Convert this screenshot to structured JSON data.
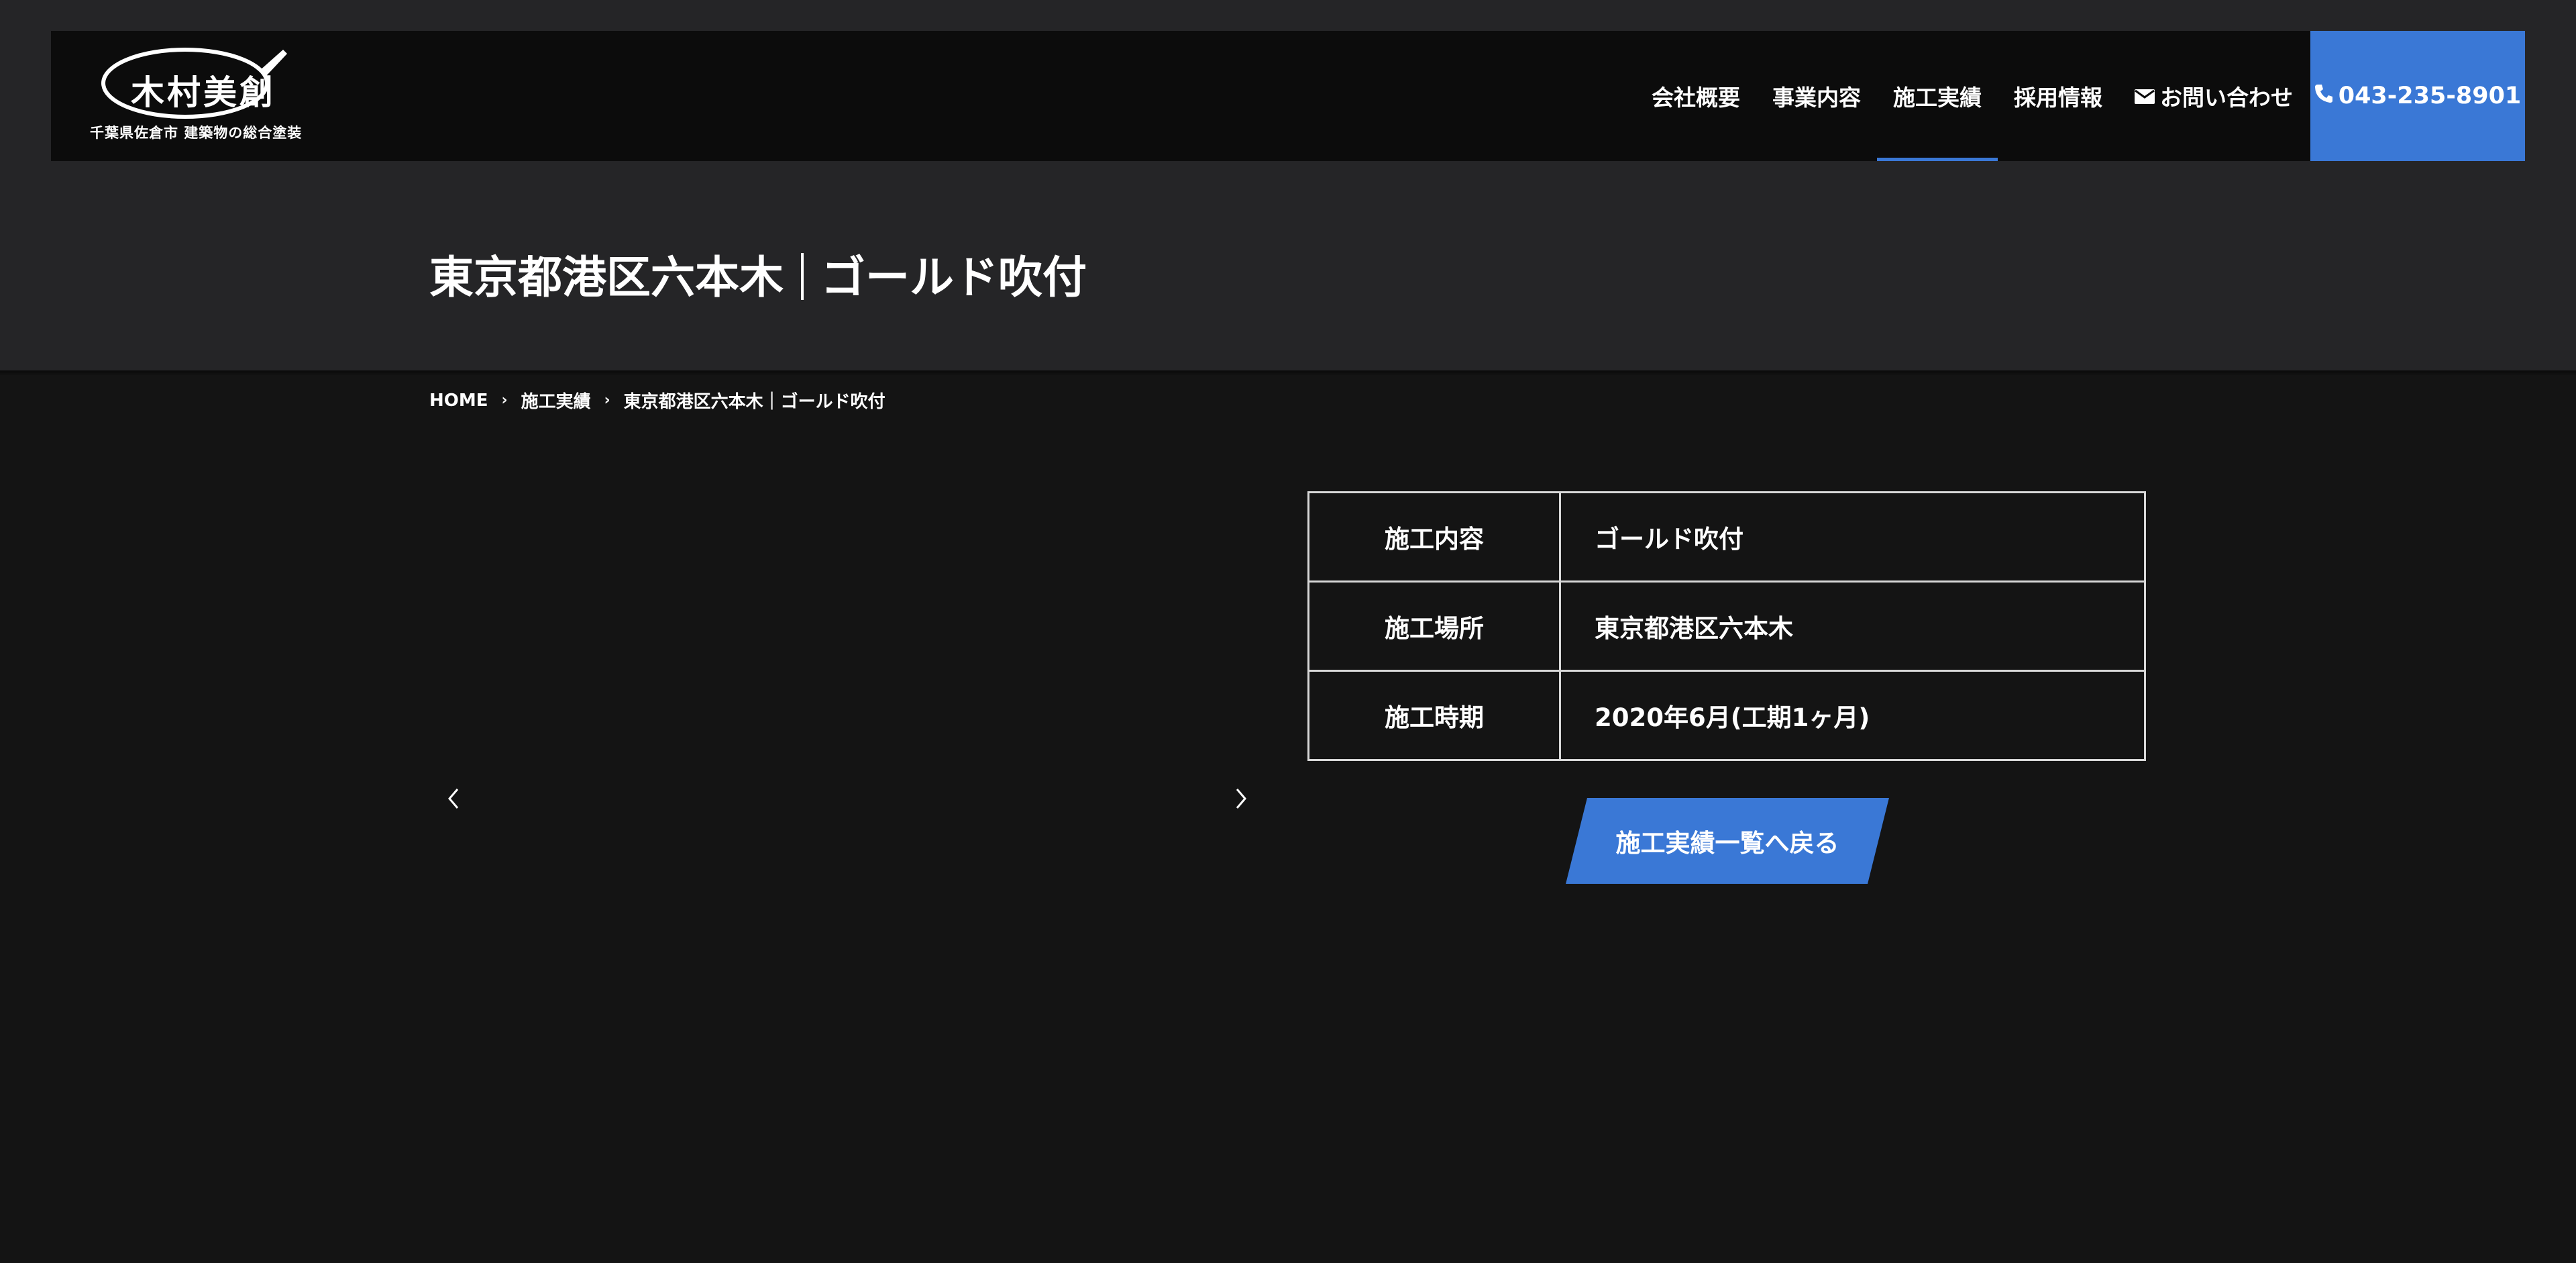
{
  "brand": {
    "logo_text": "木村美創",
    "tagline": "千葉県佐倉市 建築物の総合塗装",
    "logo_icon": "paintbrush-icon"
  },
  "nav": {
    "items": [
      {
        "label": "会社概要"
      },
      {
        "label": "事業内容"
      },
      {
        "label": "施工実績"
      },
      {
        "label": "採用情報"
      },
      {
        "label": "お問い合わせ",
        "icon": "envelope-icon"
      }
    ],
    "active_index": 2,
    "phone": {
      "label": "043-235-8901",
      "icon": "phone-icon"
    }
  },
  "page": {
    "title_location": "東京都港区六本木",
    "title_work": "ゴールド吹付"
  },
  "breadcrumb": {
    "home": "HOME",
    "section": "施工実績",
    "current": "東京都港区六本木｜ゴールド吹付"
  },
  "slider": {
    "prev_icon": "chevron-left-icon",
    "next_icon": "chevron-right-icon"
  },
  "details": [
    {
      "key": "施工内容",
      "value": "ゴールド吹付"
    },
    {
      "key": "施工場所",
      "value": "東京都港区六本木"
    },
    {
      "key": "施工時期",
      "value": "2020年6月(工期1ヶ月)"
    }
  ],
  "back_button": "施工実績一覧へ戻る",
  "colors": {
    "accent": "#3a78d6",
    "header_bg": "#0c0c0c",
    "band_bg": "#252527",
    "page_bg": "#141414"
  }
}
